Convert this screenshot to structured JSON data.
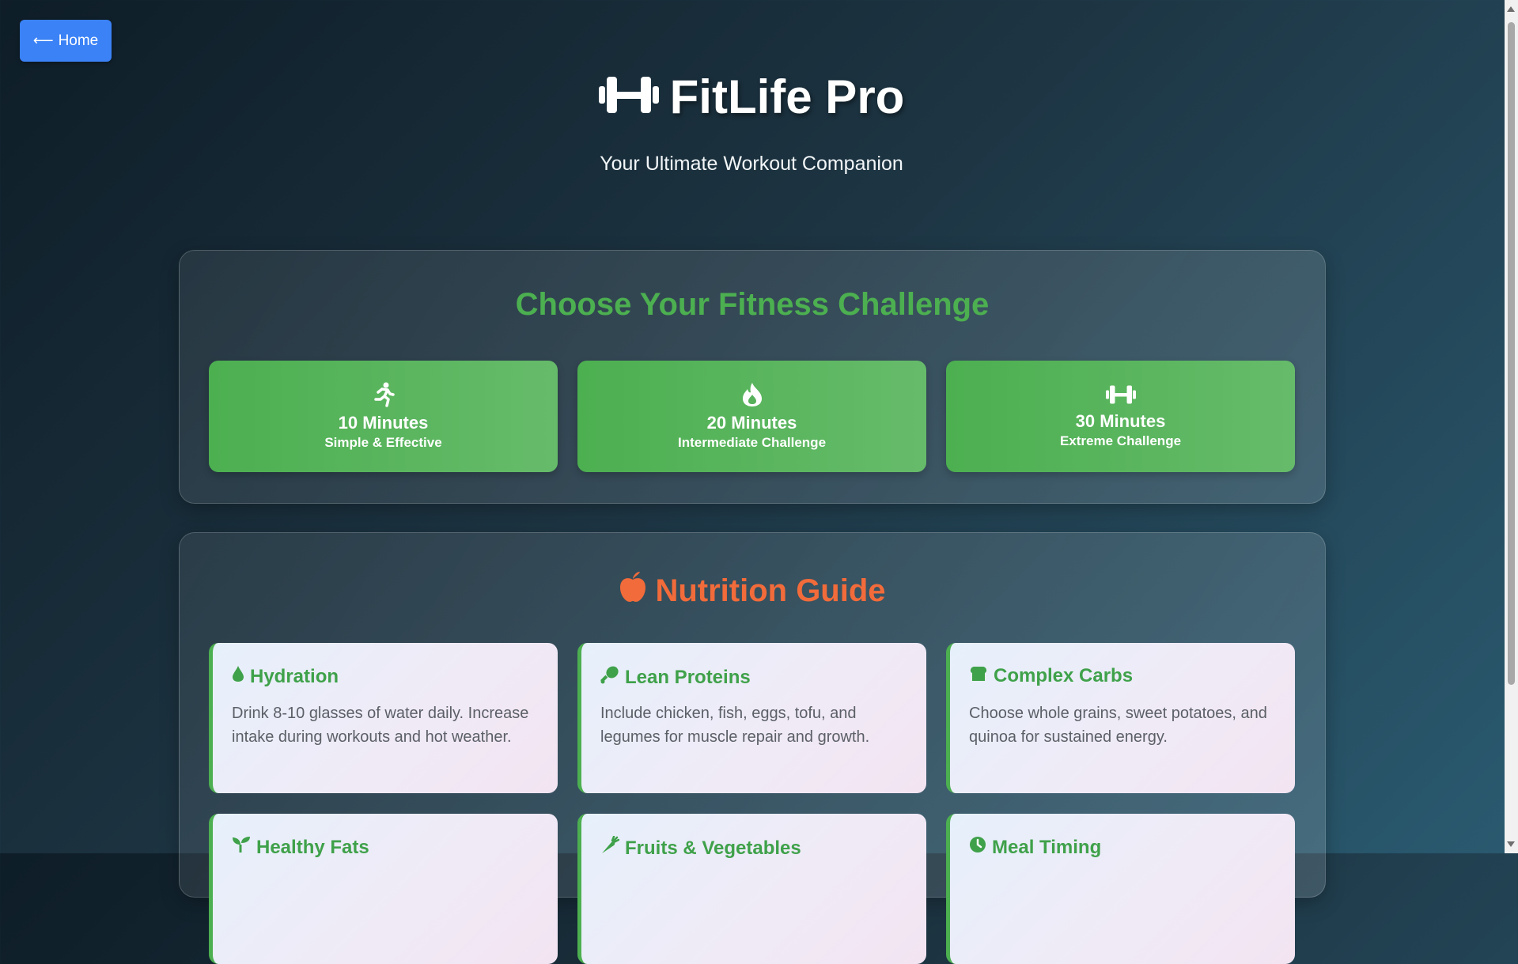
{
  "nav": {
    "home_label": "Home",
    "home_icon": "arrow-left-icon"
  },
  "header": {
    "title": "FitLife Pro",
    "subtitle": "Your Ultimate Workout Companion",
    "icon": "dumbbell-icon"
  },
  "challenge": {
    "heading": "Choose Your Fitness Challenge",
    "options": [
      {
        "icon": "running-icon",
        "minutes": "10 Minutes",
        "description": "Simple & Effective"
      },
      {
        "icon": "fire-icon",
        "minutes": "20 Minutes",
        "description": "Intermediate Challenge"
      },
      {
        "icon": "dumbbell-icon",
        "minutes": "30 Minutes",
        "description": "Extreme Challenge"
      }
    ]
  },
  "nutrition": {
    "heading": "Nutrition Guide",
    "icon": "apple-icon",
    "items": [
      {
        "icon": "water-drop-icon",
        "title": "Hydration",
        "text": "Drink 8-10 glasses of water daily. Increase intake during workouts and hot weather."
      },
      {
        "icon": "drumstick-icon",
        "title": "Lean Proteins",
        "text": "Include chicken, fish, eggs, tofu, and legumes for muscle repair and growth."
      },
      {
        "icon": "bread-icon",
        "title": "Complex Carbs",
        "text": "Choose whole grains, sweet potatoes, and quinoa for sustained energy."
      },
      {
        "icon": "seedling-icon",
        "title": "Healthy Fats",
        "text": ""
      },
      {
        "icon": "carrot-icon",
        "title": "Fruits & Vegetables",
        "text": ""
      },
      {
        "icon": "clock-icon",
        "title": "Meal Timing",
        "text": ""
      }
    ]
  },
  "colors": {
    "accent_green": "#4caf50",
    "accent_orange": "#f26b3a",
    "home_blue": "#3b82f6"
  }
}
